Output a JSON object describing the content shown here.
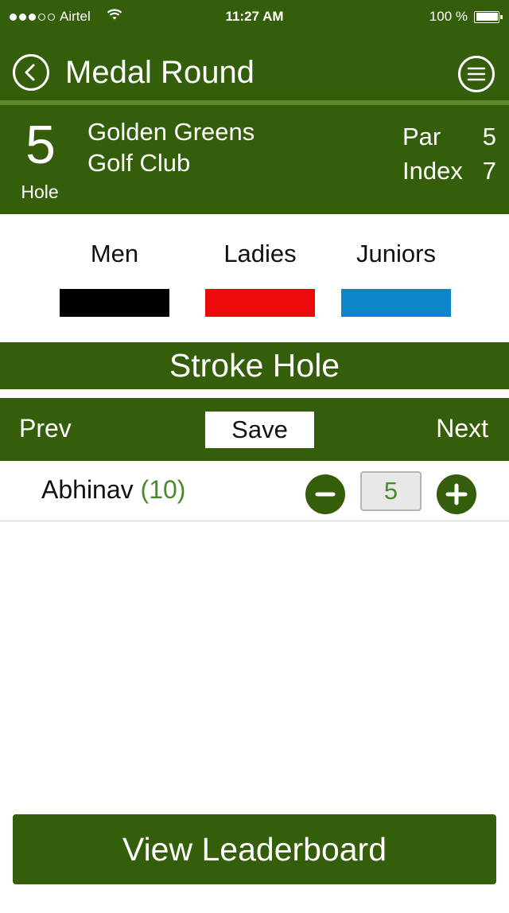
{
  "status_bar": {
    "carrier": "Airtel",
    "time": "11:27 AM",
    "battery": "100 %",
    "signal_dots_filled": 3,
    "signal_dots_total": 5
  },
  "nav": {
    "title": "Medal Round",
    "back_icon": "chevron-left-icon",
    "menu_icon": "hamburger-menu-icon"
  },
  "hole": {
    "number": "5",
    "label": "Hole",
    "club_line1": "Golden Greens",
    "club_line2": "Golf Club",
    "par_label": "Par",
    "par_value": "5",
    "index_label": "Index",
    "index_value": "7"
  },
  "tees": [
    {
      "label": "Men",
      "color": "#000000"
    },
    {
      "label": "Ladies",
      "color": "#ec0a0a"
    },
    {
      "label": "Juniors",
      "color": "#0b87c9"
    }
  ],
  "stroke_hole_label": "Stroke Hole",
  "actions": {
    "prev": "Prev",
    "save": "Save",
    "next": "Next"
  },
  "player": {
    "name": "Abhinav",
    "handicap": "(10)",
    "score": "5"
  },
  "leaderboard_button": "View Leaderboard",
  "colors": {
    "primary_green": "#355e0b",
    "accent_green": "#4a8a2a"
  }
}
